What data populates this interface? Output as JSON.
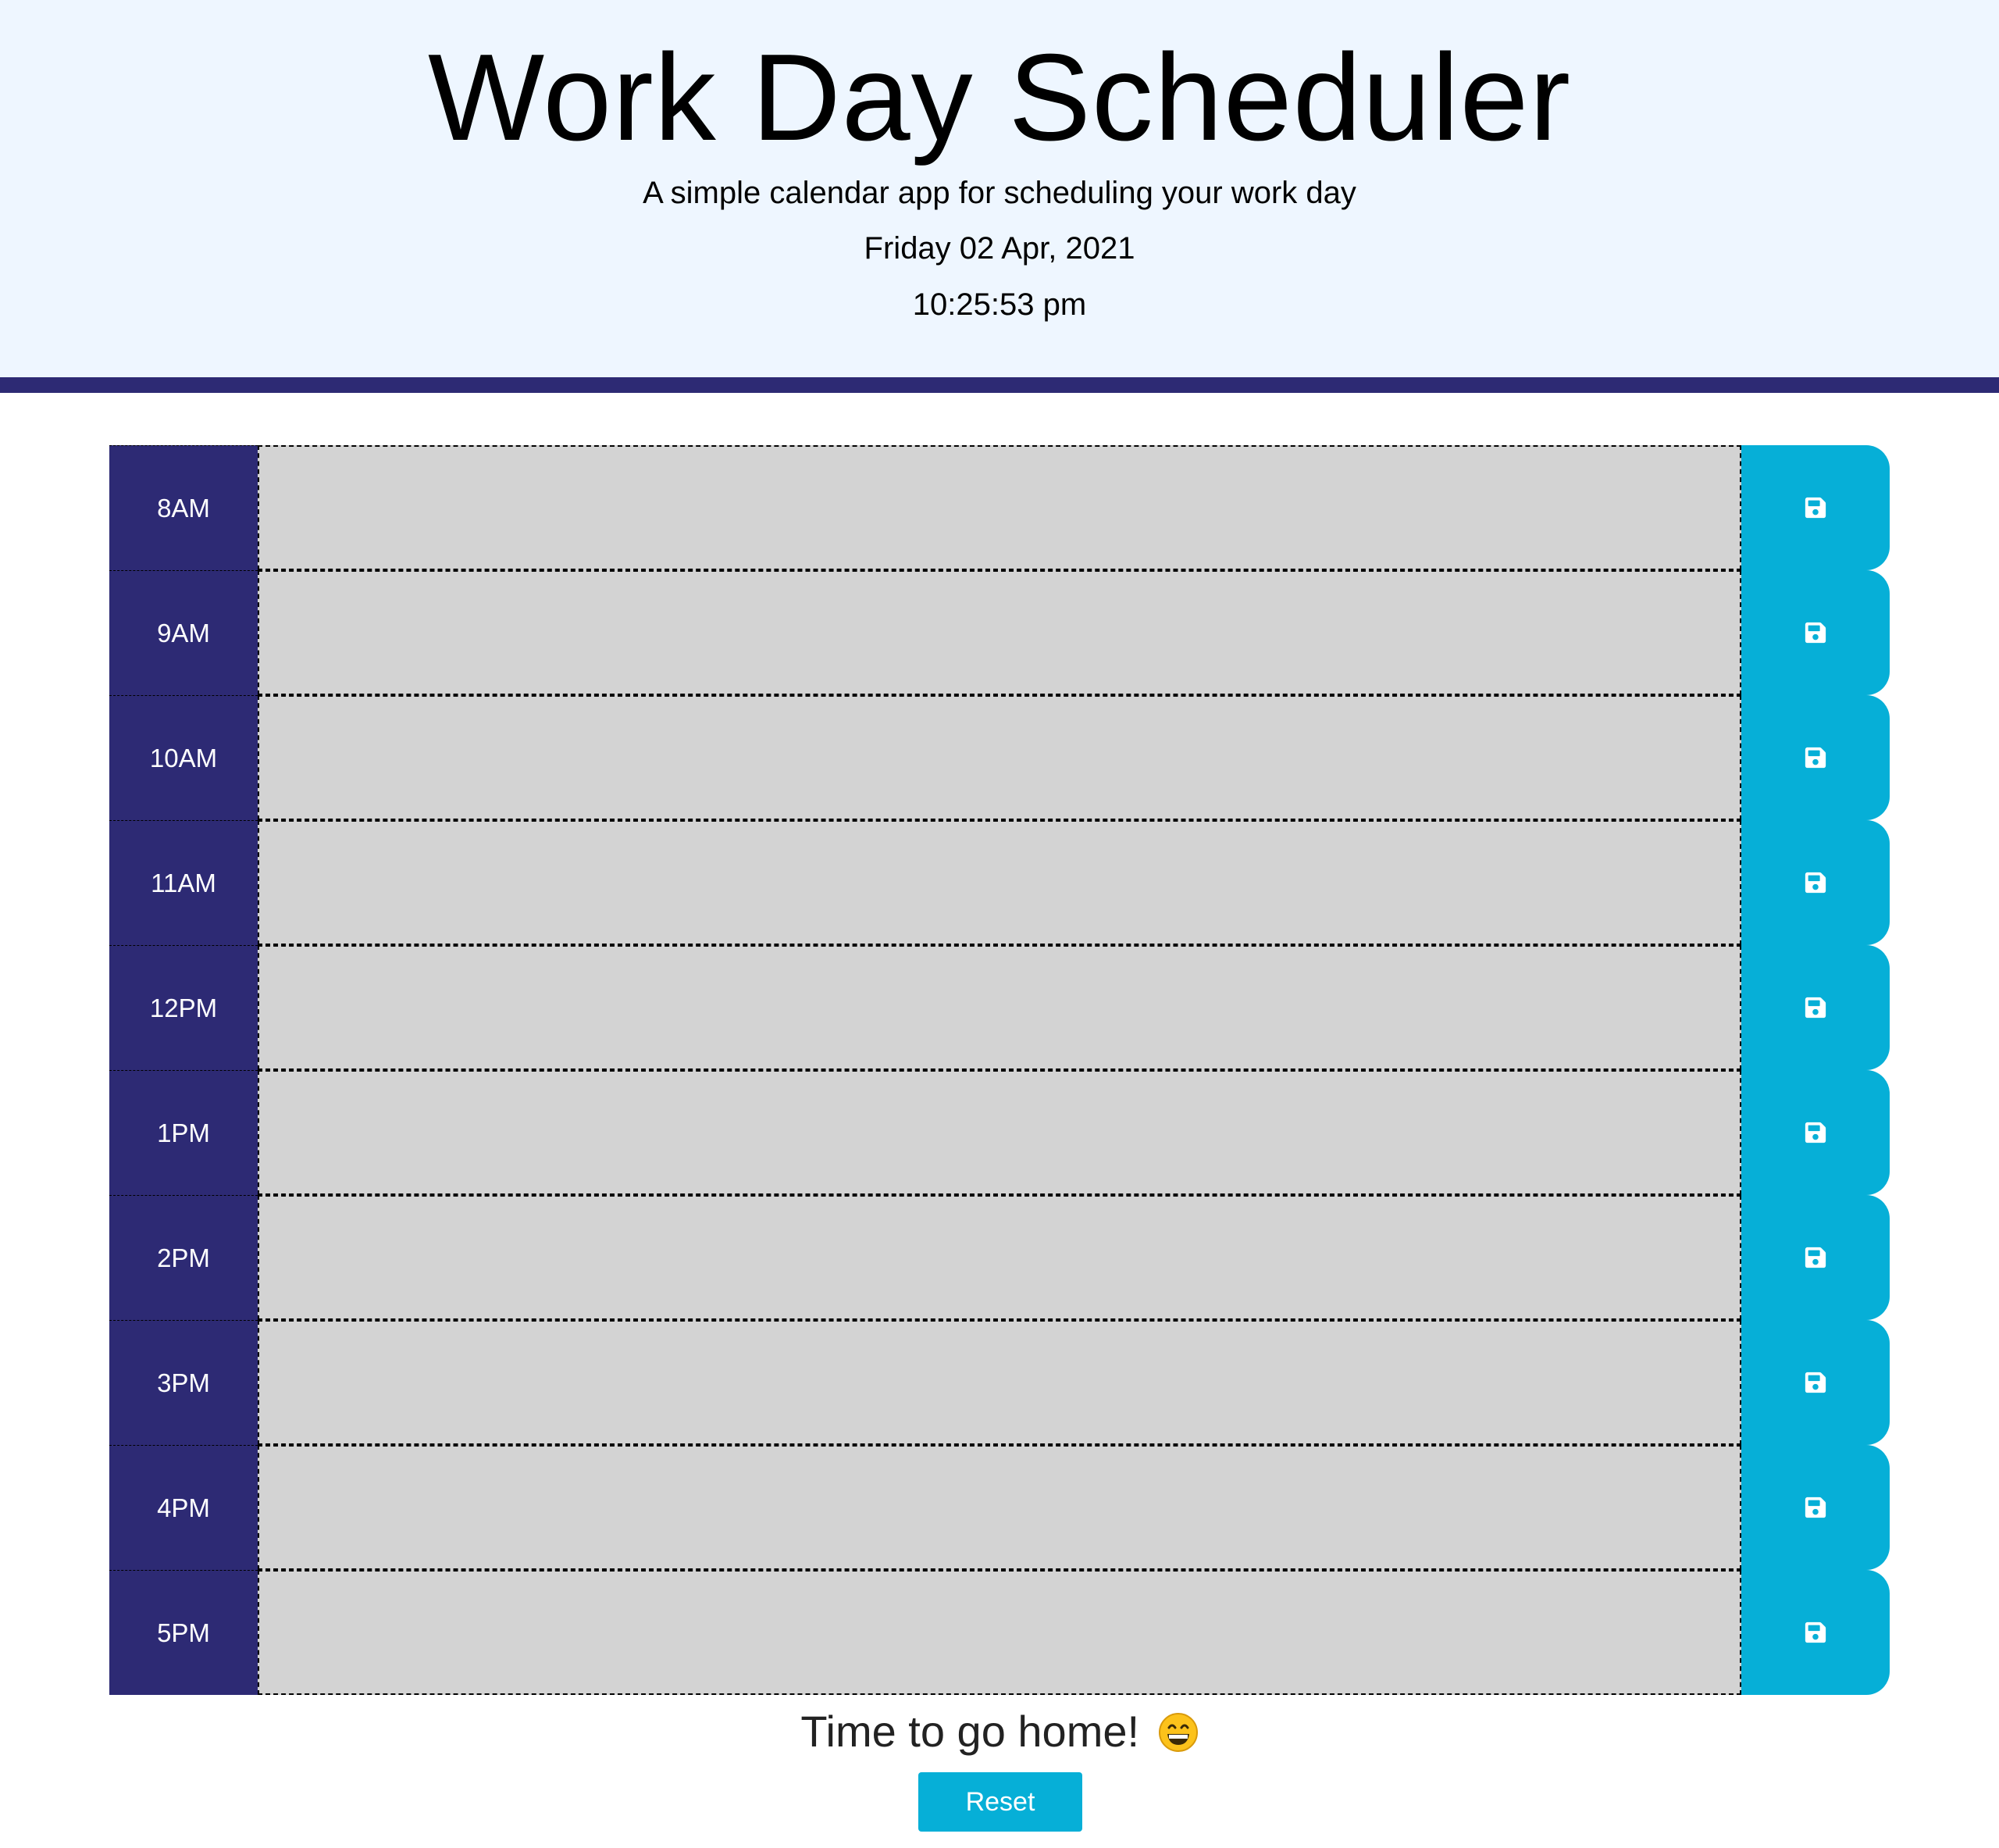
{
  "header": {
    "title": "Work Day Scheduler",
    "subtitle": "A simple calendar app for scheduling your work day",
    "date": "Friday 02 Apr, 2021",
    "time": "10:25:53 pm"
  },
  "colors": {
    "header_bg": "#eef6ff",
    "header_border": "#2d2a74",
    "hour_bg": "#2d2a74",
    "past_block": "#d3d3d3",
    "save_button": "#06afd7"
  },
  "schedule": {
    "hours": [
      {
        "label": "8AM",
        "entry": "",
        "save_icon": "save-icon"
      },
      {
        "label": "9AM",
        "entry": "",
        "save_icon": "save-icon"
      },
      {
        "label": "10AM",
        "entry": "",
        "save_icon": "save-icon"
      },
      {
        "label": "11AM",
        "entry": "",
        "save_icon": "save-icon"
      },
      {
        "label": "12PM",
        "entry": "",
        "save_icon": "save-icon"
      },
      {
        "label": "1PM",
        "entry": "",
        "save_icon": "save-icon"
      },
      {
        "label": "2PM",
        "entry": "",
        "save_icon": "save-icon"
      },
      {
        "label": "3PM",
        "entry": "",
        "save_icon": "save-icon"
      },
      {
        "label": "4PM",
        "entry": "",
        "save_icon": "save-icon"
      },
      {
        "label": "5PM",
        "entry": "",
        "save_icon": "save-icon"
      }
    ]
  },
  "footer": {
    "message": "Time to go home!",
    "emoji_icon": "grinning-face-icon",
    "reset_label": "Reset"
  }
}
